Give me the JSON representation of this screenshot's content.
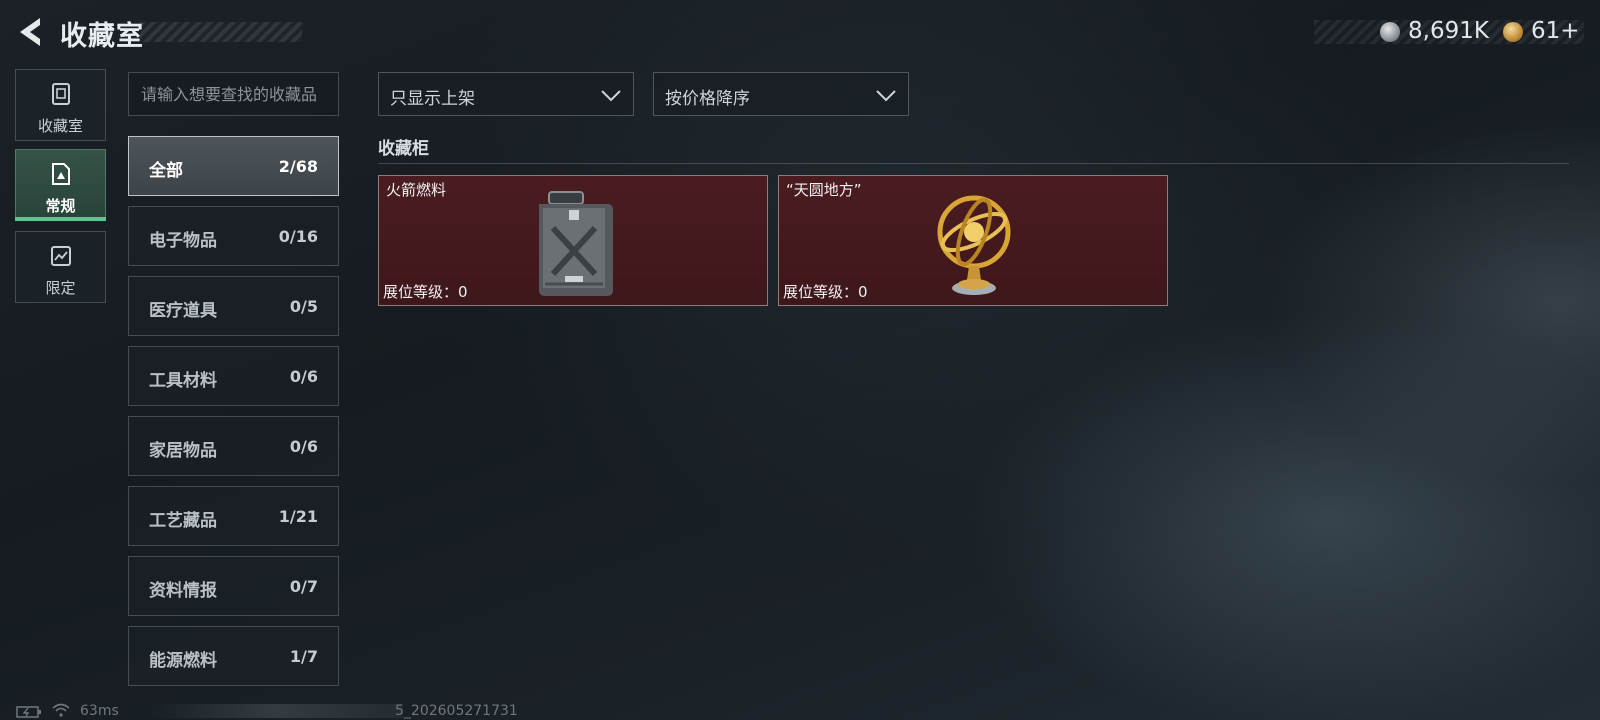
{
  "header": {
    "title": "收藏室",
    "currencies": [
      {
        "icon": "silver-coin-icon",
        "value": "8,691K"
      },
      {
        "icon": "gold-coin-icon",
        "value": "61+"
      }
    ]
  },
  "nav": {
    "items": [
      {
        "label": "收藏室",
        "icon": "collection-room-icon",
        "active": false
      },
      {
        "label": "常规",
        "icon": "regular-tab-icon",
        "active": true
      },
      {
        "label": "限定",
        "icon": "limited-tab-icon",
        "active": false
      }
    ]
  },
  "search": {
    "placeholder": "请输入想要查找的收藏品"
  },
  "categories": [
    {
      "name": "全部",
      "count": "2/68",
      "active": true
    },
    {
      "name": "电子物品",
      "count": "0/16",
      "active": false
    },
    {
      "name": "医疗道具",
      "count": "0/5",
      "active": false
    },
    {
      "name": "工具材料",
      "count": "0/6",
      "active": false
    },
    {
      "name": "家居物品",
      "count": "0/6",
      "active": false
    },
    {
      "name": "工艺藏品",
      "count": "1/21",
      "active": false
    },
    {
      "name": "资料情报",
      "count": "0/7",
      "active": false
    },
    {
      "name": "能源燃料",
      "count": "1/7",
      "active": false
    }
  ],
  "filters": {
    "display_filter": "只显示上架",
    "sort": "按价格降序"
  },
  "cabinet": {
    "title": "收藏柜",
    "items": [
      {
        "name": "火箭燃料",
        "level_label": "展位等级：0",
        "image": "fuel-canister-image",
        "card_color": "#4a1c20"
      },
      {
        "name": "“天圆地方”",
        "level_label": "展位等级：0",
        "image": "armillary-sphere-image",
        "card_color": "#4a1c20"
      }
    ]
  },
  "footer": {
    "ping": "63ms",
    "build": "5_202605271731"
  },
  "colors": {
    "accent_green": "#59c590",
    "card_red": "#4a1c20"
  }
}
